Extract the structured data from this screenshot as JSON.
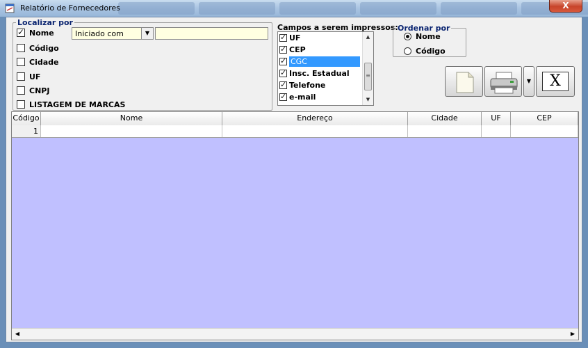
{
  "window": {
    "title": "Relatório de Fornecedores",
    "close_label": "X"
  },
  "localizar": {
    "legend": "Localizar por",
    "options": [
      {
        "label": "Nome",
        "checked": true
      },
      {
        "label": "Código",
        "checked": false
      },
      {
        "label": "Cidade",
        "checked": false
      },
      {
        "label": "UF",
        "checked": false
      },
      {
        "label": "CNPJ",
        "checked": false
      },
      {
        "label": "LISTAGEM DE MARCAS",
        "checked": false
      }
    ],
    "match_mode": "Iniciado com",
    "search_value": ""
  },
  "campos": {
    "label": "Campos a serem impressos:",
    "items": [
      {
        "label": "UF",
        "checked": true
      },
      {
        "label": "CEP",
        "checked": true
      },
      {
        "label": "CGC",
        "checked": true,
        "selected": true
      },
      {
        "label": "Insc. Estadual",
        "checked": true
      },
      {
        "label": "Telefone",
        "checked": true
      },
      {
        "label": "e-mail",
        "checked": true
      }
    ]
  },
  "ordenar": {
    "legend": "Ordenar por",
    "options": [
      {
        "label": "Nome",
        "selected": true
      },
      {
        "label": "Código",
        "selected": false
      }
    ]
  },
  "toolbar": {
    "new_icon": "document-icon",
    "print_icon": "printer-icon",
    "close_label": "X"
  },
  "grid": {
    "columns": [
      "Código",
      "Nome",
      "Endereço",
      "Cidade",
      "UF",
      "CEP"
    ],
    "rows": [
      [
        "1",
        "",
        "",
        "",
        "",
        ""
      ]
    ]
  },
  "colors": {
    "grid_background": "#c0c0ff",
    "selection": "#3399ff",
    "input_background": "#ffffe1"
  }
}
